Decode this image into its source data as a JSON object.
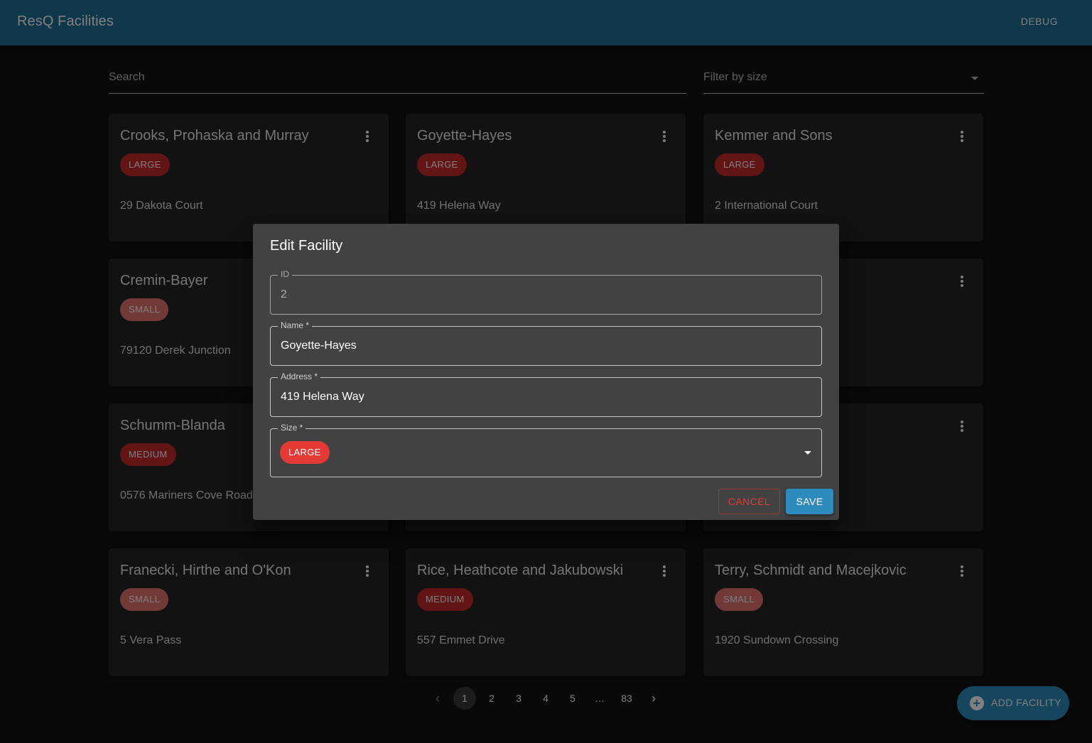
{
  "app": {
    "title": "ResQ Facilities",
    "debug_label": "DEBUG"
  },
  "filters": {
    "search_placeholder": "Search",
    "size_placeholder": "Filter by size"
  },
  "cards": [
    {
      "name": "Crooks, Prohaska and Murray",
      "size": "LARGE",
      "address": "29 Dakota Court"
    },
    {
      "name": "Goyette-Hayes",
      "size": "LARGE",
      "address": "419 Helena Way"
    },
    {
      "name": "Kemmer and Sons",
      "size": "LARGE",
      "address": "2 International Court"
    },
    {
      "name": "Cremin-Bayer",
      "size": "SMALL",
      "address": "79120 Derek Junction"
    },
    {
      "name": "",
      "size": "",
      "address": ""
    },
    {
      "name": "",
      "size": "",
      "address": ""
    },
    {
      "name": "Schumm-Blanda",
      "size": "MEDIUM",
      "address": "0576 Mariners Cove Road"
    },
    {
      "name": "",
      "size": "",
      "address": ""
    },
    {
      "name": "",
      "size": "",
      "address": ""
    },
    {
      "name": "Franecki, Hirthe and O'Kon",
      "size": "SMALL",
      "address": "5 Vera Pass"
    },
    {
      "name": "Rice, Heathcote and Jakubowski",
      "size": "MEDIUM",
      "address": "557 Emmet Drive"
    },
    {
      "name": "Terry, Schmidt and Macejkovic",
      "size": "SMALL",
      "address": "1920 Sundown Crossing"
    }
  ],
  "pagination": {
    "prev": "‹",
    "pages": [
      "1",
      "2",
      "3",
      "4",
      "5"
    ],
    "ellipsis": "…",
    "last": "83",
    "next": "›",
    "current": "1"
  },
  "fab": {
    "label": "ADD FACILITY"
  },
  "dialog": {
    "title": "Edit Facility",
    "id_label": "ID",
    "id_value": "2",
    "name_label": "Name *",
    "name_value": "Goyette-Hayes",
    "address_label": "Address *",
    "address_value": "419 Helena Way",
    "size_label": "Size *",
    "size_value": "LARGE",
    "cancel_label": "CANCEL",
    "save_label": "SAVE"
  },
  "colors": {
    "appbar": "#1f6f94",
    "primary": "#2d8cbd",
    "danger": "#c62828",
    "small_chip": "#e57373"
  }
}
